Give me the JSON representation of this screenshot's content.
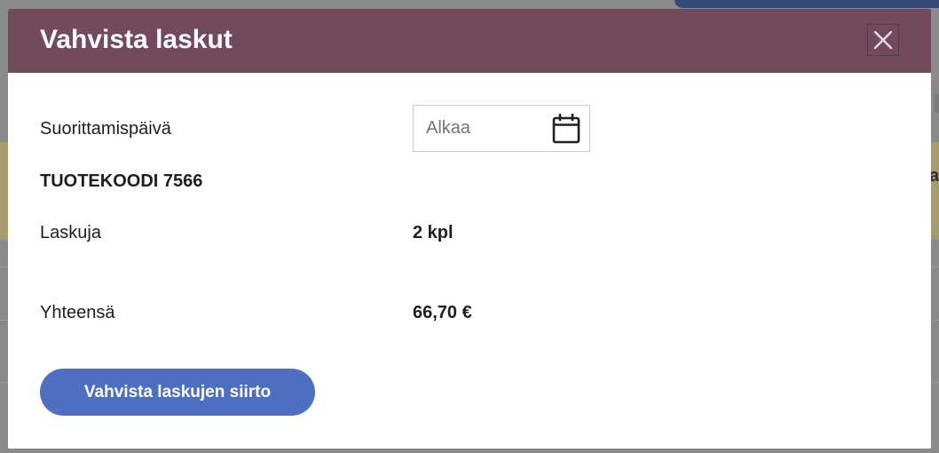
{
  "colors": {
    "header": "#734a5c",
    "primary": "#4d6fc0",
    "text": "#261b1c",
    "overlay": "#8a8a8a"
  },
  "background": {
    "partial_text": "a"
  },
  "modal": {
    "title": "Vahvista laskut",
    "close_icon": "close-icon",
    "date_field": {
      "label": "Suorittamispäivä",
      "placeholder": "Alkaa",
      "icon": "calendar-icon"
    },
    "product_code": "TUOTEKOODI 7566",
    "invoices": {
      "label": "Laskuja",
      "value": "2 kpl"
    },
    "total": {
      "label": "Yhteensä",
      "value": "66,70 €"
    },
    "confirm_button": "Vahvista laskujen siirto"
  }
}
